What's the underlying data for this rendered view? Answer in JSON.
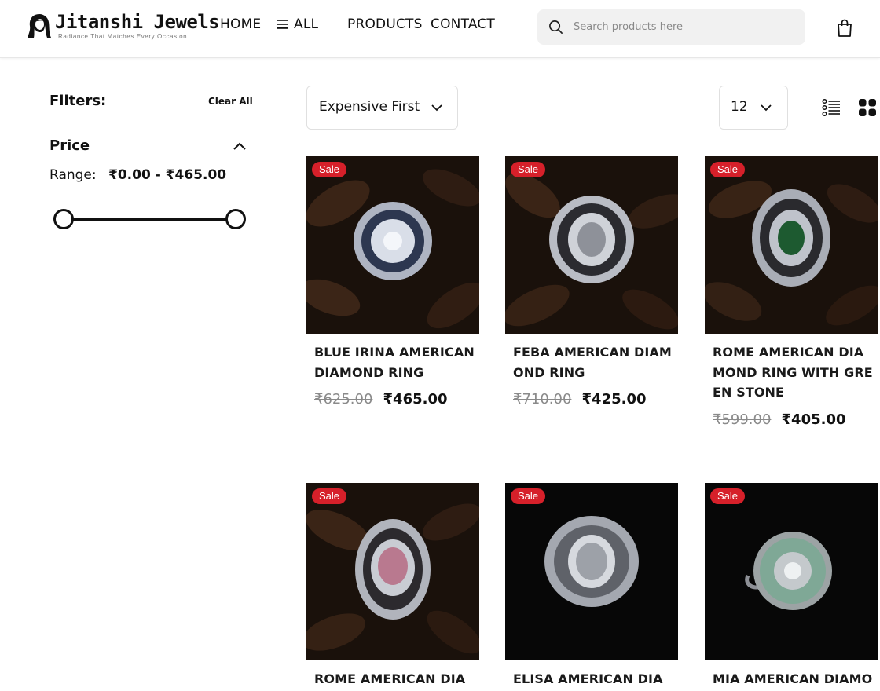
{
  "brand": {
    "name": "Jitanshi Jewels",
    "tagline": "Radiance That Matches Every Occasion"
  },
  "nav": {
    "home": "HOME",
    "all": "ALL",
    "products": "PRODUCTS",
    "contact": "CONTACT"
  },
  "search": {
    "placeholder": "Search products here",
    "icon": "search-icon"
  },
  "cart": {
    "icon": "shopping-bag-icon"
  },
  "filters": {
    "title": "Filters:",
    "clear_all": "Clear All",
    "price": {
      "title": "Price",
      "range_label": "Range:",
      "range_value": "₹0.00 - ₹465.00",
      "min": 0.0,
      "max": 465.0
    }
  },
  "toolbar": {
    "sort_selected": "Expensive First",
    "per_page_selected": "12",
    "view_modes": [
      "list-view-icon",
      "grid-view-icon"
    ],
    "active_view": "grid"
  },
  "colors": {
    "sale_badge": "#d6202a",
    "text": "#111111",
    "search_bg": "#f1f1f1"
  },
  "products": [
    {
      "badge": "Sale",
      "name": "BLUE IRINA AMERICAN DIAMOND RING",
      "old_price": "₹625.00",
      "price": "₹465.00"
    },
    {
      "badge": "Sale",
      "name": "FEBA AMERICAN DIAMOND RING",
      "old_price": "₹710.00",
      "price": "₹425.00"
    },
    {
      "badge": "Sale",
      "name": "ROME AMERICAN DIAMOND RING WITH GREEN STONE",
      "old_price": "₹599.00",
      "price": "₹405.00"
    },
    {
      "badge": "Sale",
      "name": "ROME AMERICAN DIAM"
    },
    {
      "badge": "Sale",
      "name": "ELISA AMERICAN DIAMO"
    },
    {
      "badge": "Sale",
      "name": "MIA AMERICAN DIAMON"
    }
  ]
}
